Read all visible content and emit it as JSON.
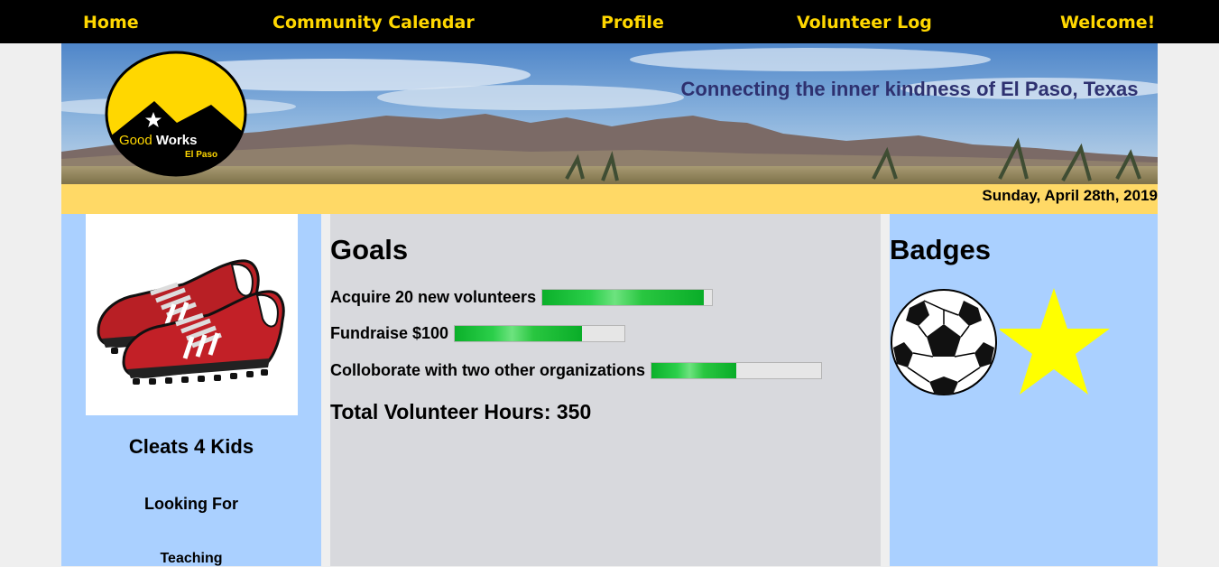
{
  "nav": {
    "home": "Home",
    "calendar": "Community Calendar",
    "profile": "Profile",
    "volunteer_log": "Volunteer Log",
    "welcome": "Welcome!"
  },
  "banner": {
    "tagline": "Connecting the inner kindness of El Paso, Texas",
    "logo_word1": "Good",
    "logo_word2": "Works",
    "logo_sub": "El Paso"
  },
  "date": "Sunday, April 28th, 2019",
  "organization": {
    "name": "Cleats 4 Kids",
    "looking_for": "Looking For",
    "need": "Teaching"
  },
  "goals": {
    "title": "Goals",
    "items": [
      {
        "label": "Acquire 20 new volunteers",
        "progress": 0.95
      },
      {
        "label": "Fundraise $100",
        "progress": 0.75
      },
      {
        "label": "Colloborate with two other organizations",
        "progress": 0.5
      }
    ],
    "total_hours": "Total Volunteer Hours: 350"
  },
  "badges": {
    "title": "Badges",
    "items": [
      "soccer-ball-icon",
      "star-icon"
    ]
  },
  "colors": {
    "nav_bg": "#000000",
    "nav_text": "#ffd700",
    "date_bar": "#ffd966",
    "side_panel": "#aad0ff",
    "main_panel": "#d8d9dd",
    "tagline": "#2e3170",
    "progress_green": "#0bb02a"
  }
}
